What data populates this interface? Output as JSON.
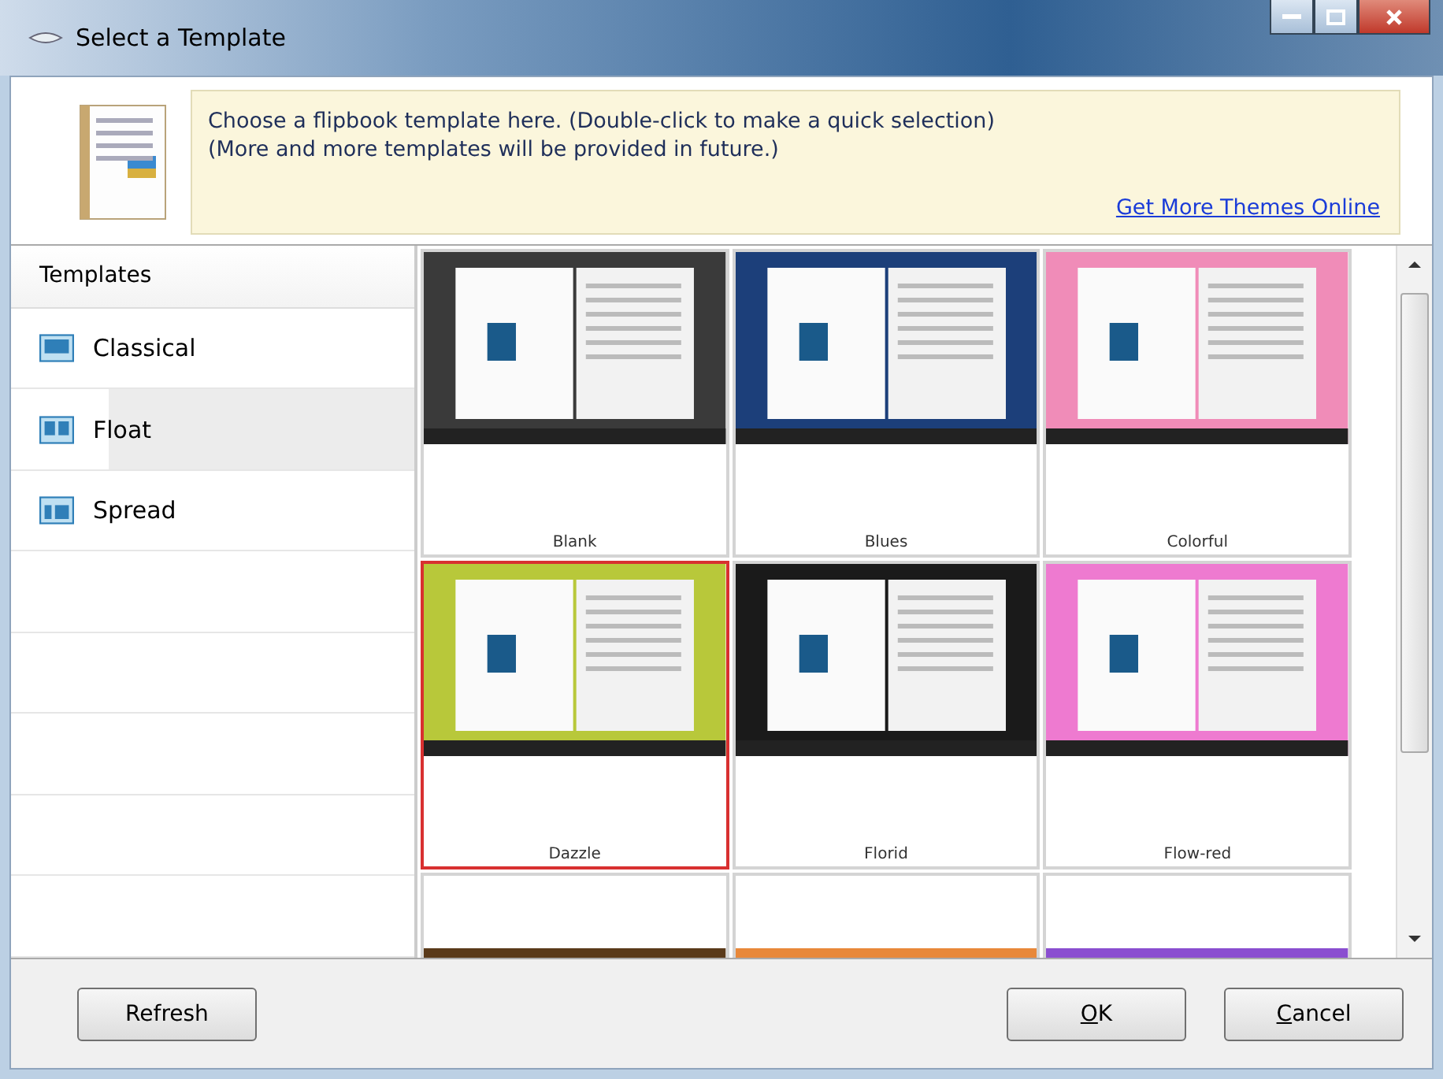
{
  "window": {
    "title": "Select a Template"
  },
  "banner": {
    "lines": [
      "Choose a flipbook template here. (Double-click to make a quick selection)",
      "(More and more templates will be provided in future.)"
    ],
    "link": "Get More Themes Online"
  },
  "sidebar": {
    "header": "Templates",
    "items": [
      {
        "label": "Classical",
        "kind": "classical",
        "selected": false
      },
      {
        "label": "Float",
        "kind": "float",
        "selected": true
      },
      {
        "label": "Spread",
        "kind": "spread",
        "selected": false
      }
    ]
  },
  "templates": [
    {
      "name": "Blank",
      "color": "#3a3a3a",
      "selected": false
    },
    {
      "name": "Blues",
      "color": "#1c3f7a",
      "selected": false
    },
    {
      "name": "Colorful",
      "color": "#f08cb8",
      "selected": false
    },
    {
      "name": "Dazzle",
      "color": "#b8c83a",
      "selected": true
    },
    {
      "name": "Florid",
      "color": "#1a1a1a",
      "selected": false
    },
    {
      "name": "Flow-red",
      "color": "#ee7ad0",
      "selected": false
    },
    {
      "color": "#5a3a1a",
      "selected": false
    },
    {
      "color": "#e8883a",
      "selected": false
    },
    {
      "color": "#8a4ed0",
      "selected": false
    }
  ],
  "buttons": {
    "refresh": "Refresh",
    "ok": "OK",
    "cancel": "Cancel"
  }
}
